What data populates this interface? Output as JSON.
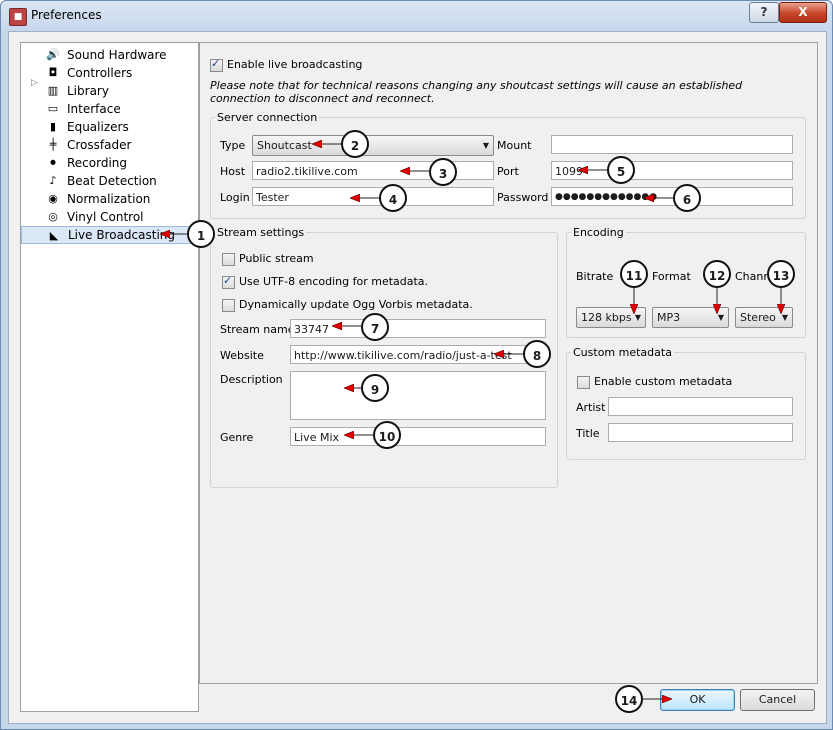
{
  "window": {
    "title": "Preferences",
    "help_label": "?",
    "close_label": "X"
  },
  "sidebar": {
    "items": [
      {
        "label": "Sound Hardware",
        "icon": "speaker-icon"
      },
      {
        "label": "Controllers",
        "icon": "controller-icon"
      },
      {
        "label": "Library",
        "icon": "library-icon"
      },
      {
        "label": "Interface",
        "icon": "monitor-icon"
      },
      {
        "label": "Equalizers",
        "icon": "equalizer-icon"
      },
      {
        "label": "Crossfader",
        "icon": "crossfader-icon"
      },
      {
        "label": "Recording",
        "icon": "recording-icon"
      },
      {
        "label": "Beat Detection",
        "icon": "beat-detection-icon"
      },
      {
        "label": "Normalization",
        "icon": "normalization-icon"
      },
      {
        "label": "Vinyl Control",
        "icon": "vinyl-icon"
      },
      {
        "label": "Live Broadcasting",
        "icon": "satellite-dish-icon"
      }
    ],
    "selected": "Live Broadcasting"
  },
  "broadcast": {
    "enable_label": "Enable live broadcasting",
    "enable_checked": true,
    "note": "Please note that for technical reasons changing any shoutcast settings will cause an established connection to disconnect and reconnect."
  },
  "server": {
    "group_label": "Server connection",
    "type_label": "Type",
    "type_value": "Shoutcast",
    "host_label": "Host",
    "host_value": "radio2.tikilive.com",
    "login_label": "Login",
    "login_value": "Tester",
    "mount_label": "Mount",
    "mount_value": "",
    "port_label": "Port",
    "port_value": "1099",
    "password_label": "Password",
    "password_value": "●●●●●●●●●●●●●"
  },
  "stream": {
    "group_label": "Stream settings",
    "public_label": "Public stream",
    "public_checked": false,
    "utf8_label": "Use UTF-8 encoding for metadata.",
    "utf8_checked": true,
    "ogg_label": "Dynamically update Ogg Vorbis metadata.",
    "ogg_checked": false,
    "name_label": "Stream name",
    "name_value": "33747",
    "website_label": "Website",
    "website_value": "http://www.tikilive.com/radio/just-a-test",
    "description_label": "Description",
    "description_value": "",
    "genre_label": "Genre",
    "genre_value": "Live Mix"
  },
  "encoding": {
    "group_label": "Encoding",
    "bitrate_label": "Bitrate",
    "bitrate_value": "128 kbps",
    "format_label": "Format",
    "format_value": "MP3",
    "channels_label": "Channe",
    "channels_value": "Stereo"
  },
  "metadata": {
    "group_label": "Custom metadata",
    "enable_label": "Enable custom metadata",
    "enable_checked": false,
    "artist_label": "Artist",
    "artist_value": "",
    "title_label": "Title",
    "title_value": ""
  },
  "buttons": {
    "ok_label": "OK",
    "cancel_label": "Cancel"
  },
  "callouts": [
    "1",
    "2",
    "3",
    "4",
    "5",
    "6",
    "7",
    "8",
    "9",
    "10",
    "11",
    "12",
    "13",
    "14"
  ],
  "colors": {
    "arrow": "#e00000",
    "selection": "#dbe8f7",
    "close": "#c8442a"
  }
}
